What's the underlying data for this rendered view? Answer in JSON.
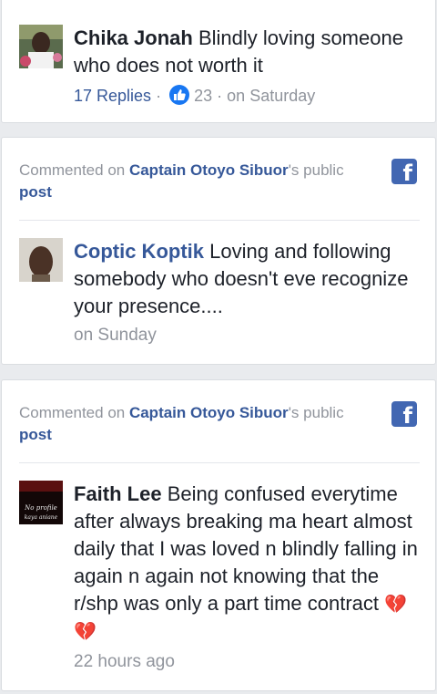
{
  "items": [
    {
      "author": "Chika Jonah",
      "text": "Blindly loving someone who does not worth it",
      "replies": "17 Replies",
      "likes": "23",
      "time": "on Saturday"
    },
    {
      "context_prefix": "Commented on ",
      "page": "Captain Otoyo Sibuor",
      "context_suffix": "'s public",
      "post_word": "post",
      "author": "Coptic Koptik",
      "text": "Loving and following somebody who doesn't eve recognize your presence....",
      "time": "on Sunday"
    },
    {
      "context_prefix": "Commented on ",
      "page": "Captain Otoyo Sibuor",
      "context_suffix": "'s public",
      "post_word": "post",
      "author": "Faith Lee",
      "text": "Being confused everytime after always breaking ma heart almost daily that I was loved n blindly falling in again n again not knowing that the r/shp was only a part time contract",
      "emoji": "💔💔",
      "time": "22 hours ago",
      "avatar_caption": "No profile kaya aniane"
    }
  ],
  "separator": "·",
  "icons": {
    "facebook": "facebook-icon",
    "like": "like-icon"
  },
  "colors": {
    "link": "#365899",
    "meta": "#90949c",
    "facebook": "#4267b2"
  }
}
